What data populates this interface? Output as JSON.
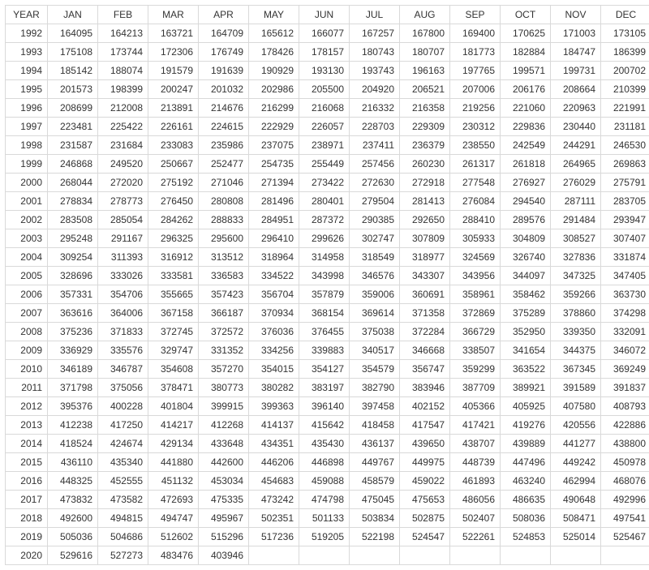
{
  "headers": [
    "YEAR",
    "JAN",
    "FEB",
    "MAR",
    "APR",
    "MAY",
    "JUN",
    "JUL",
    "AUG",
    "SEP",
    "OCT",
    "NOV",
    "DEC"
  ],
  "rows": [
    {
      "year": "1992",
      "v": [
        "164095",
        "164213",
        "163721",
        "164709",
        "165612",
        "166077",
        "167257",
        "167800",
        "169400",
        "170625",
        "171003",
        "173105"
      ]
    },
    {
      "year": "1993",
      "v": [
        "175108",
        "173744",
        "172306",
        "176749",
        "178426",
        "178157",
        "180743",
        "180707",
        "181773",
        "182884",
        "184747",
        "186399"
      ]
    },
    {
      "year": "1994",
      "v": [
        "185142",
        "188074",
        "191579",
        "191639",
        "190929",
        "193130",
        "193743",
        "196163",
        "197765",
        "199571",
        "199731",
        "200702"
      ]
    },
    {
      "year": "1995",
      "v": [
        "201573",
        "198399",
        "200247",
        "201032",
        "202986",
        "205500",
        "204920",
        "206521",
        "207006",
        "206176",
        "208664",
        "210399"
      ]
    },
    {
      "year": "1996",
      "v": [
        "208699",
        "212008",
        "213891",
        "214676",
        "216299",
        "216068",
        "216332",
        "216358",
        "219256",
        "221060",
        "220963",
        "221991"
      ]
    },
    {
      "year": "1997",
      "v": [
        "223481",
        "225422",
        "226161",
        "224615",
        "222929",
        "226057",
        "228703",
        "229309",
        "230312",
        "229836",
        "230440",
        "231181"
      ]
    },
    {
      "year": "1998",
      "v": [
        "231587",
        "231684",
        "233083",
        "235986",
        "237075",
        "238971",
        "237411",
        "236379",
        "238550",
        "242549",
        "244291",
        "246530"
      ]
    },
    {
      "year": "1999",
      "v": [
        "246868",
        "249520",
        "250667",
        "252477",
        "254735",
        "255449",
        "257456",
        "260230",
        "261317",
        "261818",
        "264965",
        "269863"
      ]
    },
    {
      "year": "2000",
      "v": [
        "268044",
        "272020",
        "275192",
        "271046",
        "271394",
        "273422",
        "272630",
        "272918",
        "277548",
        "276927",
        "276029",
        "275791"
      ]
    },
    {
      "year": "2001",
      "v": [
        "278834",
        "278773",
        "276450",
        "280808",
        "281496",
        "280401",
        "279504",
        "281413",
        "276084",
        "294540",
        "287111",
        "283705"
      ]
    },
    {
      "year": "2002",
      "v": [
        "283508",
        "285054",
        "284262",
        "288833",
        "284951",
        "287372",
        "290385",
        "292650",
        "288410",
        "289576",
        "291484",
        "293947"
      ]
    },
    {
      "year": "2003",
      "v": [
        "295248",
        "291167",
        "296325",
        "295600",
        "296410",
        "299626",
        "302747",
        "307809",
        "305933",
        "304809",
        "308527",
        "307407"
      ]
    },
    {
      "year": "2004",
      "v": [
        "309254",
        "311393",
        "316912",
        "313512",
        "318964",
        "314958",
        "318549",
        "318977",
        "324569",
        "326740",
        "327836",
        "331874"
      ]
    },
    {
      "year": "2005",
      "v": [
        "328696",
        "333026",
        "333581",
        "336583",
        "334522",
        "343998",
        "346576",
        "343307",
        "343956",
        "344097",
        "347325",
        "347405"
      ]
    },
    {
      "year": "2006",
      "v": [
        "357331",
        "354706",
        "355665",
        "357423",
        "356704",
        "357879",
        "359006",
        "360691",
        "358961",
        "358462",
        "359266",
        "363730"
      ]
    },
    {
      "year": "2007",
      "v": [
        "363616",
        "364006",
        "367158",
        "366187",
        "370934",
        "368154",
        "369614",
        "371358",
        "372869",
        "375289",
        "378860",
        "374298"
      ]
    },
    {
      "year": "2008",
      "v": [
        "375236",
        "371833",
        "372745",
        "372572",
        "376036",
        "376455",
        "375038",
        "372284",
        "366729",
        "352950",
        "339350",
        "332091"
      ]
    },
    {
      "year": "2009",
      "v": [
        "336929",
        "335576",
        "329747",
        "331352",
        "334256",
        "339883",
        "340517",
        "346668",
        "338507",
        "341654",
        "344375",
        "346072"
      ]
    },
    {
      "year": "2010",
      "v": [
        "346189",
        "346787",
        "354608",
        "357270",
        "354015",
        "354127",
        "354579",
        "356747",
        "359299",
        "363522",
        "367345",
        "369249"
      ]
    },
    {
      "year": "2011",
      "v": [
        "371798",
        "375056",
        "378471",
        "380773",
        "380282",
        "383197",
        "382790",
        "383946",
        "387709",
        "389921",
        "391589",
        "391837"
      ]
    },
    {
      "year": "2012",
      "v": [
        "395376",
        "400228",
        "401804",
        "399915",
        "399363",
        "396140",
        "397458",
        "402152",
        "405366",
        "405925",
        "407580",
        "408793"
      ]
    },
    {
      "year": "2013",
      "v": [
        "412238",
        "417250",
        "414217",
        "412268",
        "414137",
        "415642",
        "418458",
        "417547",
        "417421",
        "419276",
        "420556",
        "422886"
      ]
    },
    {
      "year": "2014",
      "v": [
        "418524",
        "424674",
        "429134",
        "433648",
        "434351",
        "435430",
        "436137",
        "439650",
        "438707",
        "439889",
        "441277",
        "438800"
      ]
    },
    {
      "year": "2015",
      "v": [
        "436110",
        "435340",
        "441880",
        "442600",
        "446206",
        "446898",
        "449767",
        "449975",
        "448739",
        "447496",
        "449242",
        "450978"
      ]
    },
    {
      "year": "2016",
      "v": [
        "448325",
        "452555",
        "451132",
        "453034",
        "454683",
        "459088",
        "458579",
        "459022",
        "461893",
        "463240",
        "462994",
        "468076"
      ]
    },
    {
      "year": "2017",
      "v": [
        "473832",
        "473582",
        "472693",
        "475335",
        "473242",
        "474798",
        "475045",
        "475653",
        "486056",
        "486635",
        "490648",
        "492996"
      ]
    },
    {
      "year": "2018",
      "v": [
        "492600",
        "494815",
        "494747",
        "495967",
        "502351",
        "501133",
        "503834",
        "502875",
        "502407",
        "508036",
        "508471",
        "497541"
      ]
    },
    {
      "year": "2019",
      "v": [
        "505036",
        "504686",
        "512602",
        "515296",
        "517236",
        "519205",
        "522198",
        "524547",
        "522261",
        "524853",
        "525014",
        "525467"
      ]
    },
    {
      "year": "2020",
      "v": [
        "529616",
        "527273",
        "483476",
        "403946",
        "",
        "",
        "",
        "",
        "",
        "",
        "",
        ""
      ]
    }
  ]
}
